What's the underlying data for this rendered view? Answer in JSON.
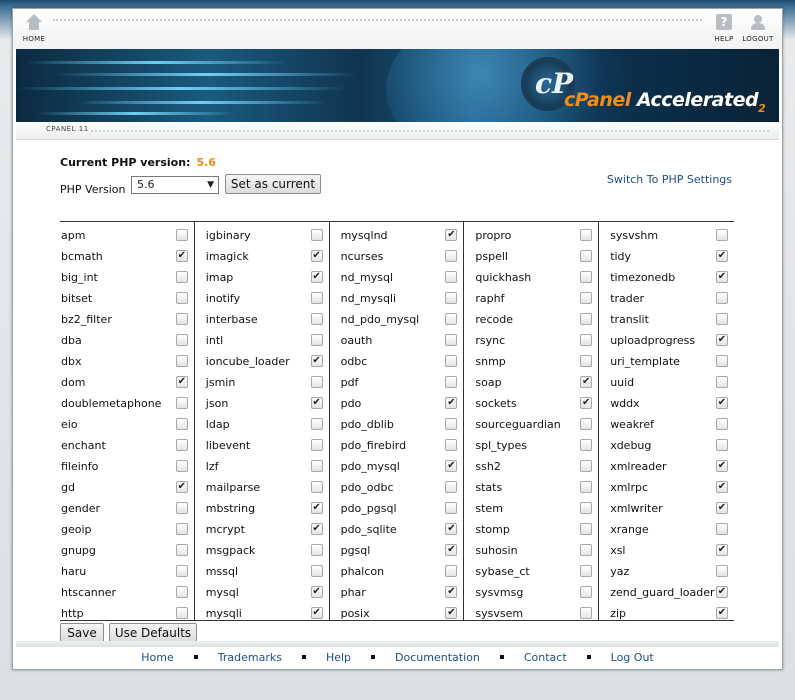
{
  "topnav": {
    "home_label": "HOME",
    "help_label": "HELP",
    "logout_label": "LOGOUT",
    "help_glyph": "?"
  },
  "banner": {
    "logo_mark": "cP",
    "brand_cpanel": "cPanel",
    "brand_accelerated": "Accelerated",
    "brand_sub": "2"
  },
  "breadcrumb": "CPANEL 11",
  "php": {
    "current_label": "Current PHP version:",
    "current_value": "5.6",
    "version_label": "PHP Version",
    "selected_version": "5.6",
    "set_current_label": "Set as current",
    "switch_link": "Switch To PHP Settings"
  },
  "extensions": [
    [
      {
        "name": "apm",
        "checked": false
      },
      {
        "name": "bcmath",
        "checked": true
      },
      {
        "name": "big_int",
        "checked": false
      },
      {
        "name": "bitset",
        "checked": false
      },
      {
        "name": "bz2_filter",
        "checked": false
      },
      {
        "name": "dba",
        "checked": false
      },
      {
        "name": "dbx",
        "checked": false
      },
      {
        "name": "dom",
        "checked": true
      },
      {
        "name": "doublemetaphone",
        "checked": false
      },
      {
        "name": "eio",
        "checked": false
      },
      {
        "name": "enchant",
        "checked": false
      },
      {
        "name": "fileinfo",
        "checked": false
      },
      {
        "name": "gd",
        "checked": true
      },
      {
        "name": "gender",
        "checked": false
      },
      {
        "name": "geoip",
        "checked": false
      },
      {
        "name": "gnupg",
        "checked": false
      },
      {
        "name": "haru",
        "checked": false
      },
      {
        "name": "htscanner",
        "checked": false
      },
      {
        "name": "http",
        "checked": false
      }
    ],
    [
      {
        "name": "igbinary",
        "checked": false
      },
      {
        "name": "imagick",
        "checked": true
      },
      {
        "name": "imap",
        "checked": true
      },
      {
        "name": "inotify",
        "checked": false
      },
      {
        "name": "interbase",
        "checked": false
      },
      {
        "name": "intl",
        "checked": false
      },
      {
        "name": "ioncube_loader",
        "checked": true
      },
      {
        "name": "jsmin",
        "checked": false
      },
      {
        "name": "json",
        "checked": true
      },
      {
        "name": "ldap",
        "checked": false
      },
      {
        "name": "libevent",
        "checked": false
      },
      {
        "name": "lzf",
        "checked": false
      },
      {
        "name": "mailparse",
        "checked": false
      },
      {
        "name": "mbstring",
        "checked": true
      },
      {
        "name": "mcrypt",
        "checked": true
      },
      {
        "name": "msgpack",
        "checked": false
      },
      {
        "name": "mssql",
        "checked": false
      },
      {
        "name": "mysql",
        "checked": true
      },
      {
        "name": "mysqli",
        "checked": true
      }
    ],
    [
      {
        "name": "mysqlnd",
        "checked": true
      },
      {
        "name": "ncurses",
        "checked": false
      },
      {
        "name": "nd_mysql",
        "checked": false
      },
      {
        "name": "nd_mysqli",
        "checked": false
      },
      {
        "name": "nd_pdo_mysql",
        "checked": false
      },
      {
        "name": "oauth",
        "checked": false
      },
      {
        "name": "odbc",
        "checked": false
      },
      {
        "name": "pdf",
        "checked": false
      },
      {
        "name": "pdo",
        "checked": true
      },
      {
        "name": "pdo_dblib",
        "checked": false
      },
      {
        "name": "pdo_firebird",
        "checked": false
      },
      {
        "name": "pdo_mysql",
        "checked": true
      },
      {
        "name": "pdo_odbc",
        "checked": false
      },
      {
        "name": "pdo_pgsql",
        "checked": false
      },
      {
        "name": "pdo_sqlite",
        "checked": true
      },
      {
        "name": "pgsql",
        "checked": true
      },
      {
        "name": "phalcon",
        "checked": false
      },
      {
        "name": "phar",
        "checked": true
      },
      {
        "name": "posix",
        "checked": true
      }
    ],
    [
      {
        "name": "propro",
        "checked": false
      },
      {
        "name": "pspell",
        "checked": false
      },
      {
        "name": "quickhash",
        "checked": false
      },
      {
        "name": "raphf",
        "checked": false
      },
      {
        "name": "recode",
        "checked": false
      },
      {
        "name": "rsync",
        "checked": false
      },
      {
        "name": "snmp",
        "checked": false
      },
      {
        "name": "soap",
        "checked": true
      },
      {
        "name": "sockets",
        "checked": true
      },
      {
        "name": "sourceguardian",
        "checked": false
      },
      {
        "name": "spl_types",
        "checked": false
      },
      {
        "name": "ssh2",
        "checked": false
      },
      {
        "name": "stats",
        "checked": false
      },
      {
        "name": "stem",
        "checked": false
      },
      {
        "name": "stomp",
        "checked": false
      },
      {
        "name": "suhosin",
        "checked": false
      },
      {
        "name": "sybase_ct",
        "checked": false
      },
      {
        "name": "sysvmsg",
        "checked": false
      },
      {
        "name": "sysvsem",
        "checked": false
      }
    ],
    [
      {
        "name": "sysvshm",
        "checked": false
      },
      {
        "name": "tidy",
        "checked": true
      },
      {
        "name": "timezonedb",
        "checked": true
      },
      {
        "name": "trader",
        "checked": false
      },
      {
        "name": "translit",
        "checked": false
      },
      {
        "name": "uploadprogress",
        "checked": true
      },
      {
        "name": "uri_template",
        "checked": false
      },
      {
        "name": "uuid",
        "checked": false
      },
      {
        "name": "wddx",
        "checked": true
      },
      {
        "name": "weakref",
        "checked": false
      },
      {
        "name": "xdebug",
        "checked": false
      },
      {
        "name": "xmlreader",
        "checked": true
      },
      {
        "name": "xmlrpc",
        "checked": true
      },
      {
        "name": "xmlwriter",
        "checked": true
      },
      {
        "name": "xrange",
        "checked": false
      },
      {
        "name": "xsl",
        "checked": true
      },
      {
        "name": "yaz",
        "checked": false
      },
      {
        "name": "zend_guard_loader",
        "checked": true
      },
      {
        "name": "zip",
        "checked": true
      }
    ]
  ],
  "actions": {
    "save_label": "Save",
    "defaults_label": "Use Defaults"
  },
  "footer": [
    "Home",
    "Trademarks",
    "Help",
    "Documentation",
    "Contact",
    "Log Out"
  ],
  "icons": {
    "checkmark": "✔",
    "dropdown": "▼"
  }
}
